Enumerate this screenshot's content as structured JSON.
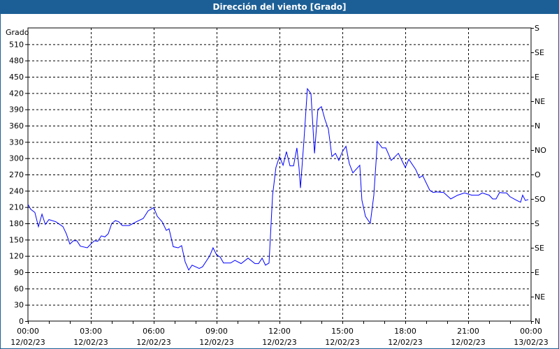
{
  "window": {
    "title": "Dirección del viento [Grado]"
  },
  "colors": {
    "titlebar": "#1c5f96",
    "line": "#0000ff",
    "grid": "#000000"
  },
  "chart_data": {
    "type": "line",
    "title": "Dirección del viento [Grado]",
    "ylabel": "Grado",
    "ylim": [
      0,
      540
    ],
    "xlim_hours": [
      0,
      24
    ],
    "grid": true,
    "yticks": [
      0,
      30,
      60,
      90,
      120,
      150,
      180,
      210,
      240,
      270,
      300,
      330,
      360,
      390,
      420,
      450,
      480,
      510
    ],
    "right_axis_labels": [
      {
        "value": 0,
        "label": "N"
      },
      {
        "value": 45,
        "label": "NE"
      },
      {
        "value": 90,
        "label": "E"
      },
      {
        "value": 135,
        "label": "SE"
      },
      {
        "value": 180,
        "label": "S"
      },
      {
        "value": 225,
        "label": "SO"
      },
      {
        "value": 270,
        "label": "O"
      },
      {
        "value": 315,
        "label": "NO"
      },
      {
        "value": 360,
        "label": "N"
      },
      {
        "value": 405,
        "label": "NE"
      },
      {
        "value": 450,
        "label": "E"
      },
      {
        "value": 495,
        "label": "SE"
      },
      {
        "value": 540,
        "label": "S"
      }
    ],
    "xticks": [
      {
        "hour": 0,
        "time": "00:00",
        "date": "12/02/23"
      },
      {
        "hour": 3,
        "time": "03:00",
        "date": "12/02/23"
      },
      {
        "hour": 6,
        "time": "06:00",
        "date": "12/02/23"
      },
      {
        "hour": 9,
        "time": "09:00",
        "date": "12/02/23"
      },
      {
        "hour": 12,
        "time": "12:00",
        "date": "12/02/23"
      },
      {
        "hour": 15,
        "time": "15:00",
        "date": "12/02/23"
      },
      {
        "hour": 18,
        "time": "18:00",
        "date": "12/02/23"
      },
      {
        "hour": 21,
        "time": "21:00",
        "date": "12/02/23"
      },
      {
        "hour": 24,
        "time": "00:00",
        "date": "13/02/23"
      }
    ],
    "series": [
      {
        "name": "Dirección del viento",
        "x": [
          0,
          0.13,
          0.33,
          0.5,
          0.67,
          0.83,
          1.0,
          1.33,
          1.67,
          1.83,
          2.0,
          2.17,
          2.33,
          2.5,
          2.83,
          3.0,
          3.17,
          3.33,
          3.5,
          3.67,
          3.83,
          4.0,
          4.17,
          4.33,
          4.5,
          4.83,
          5.17,
          5.5,
          5.73,
          6.0,
          6.17,
          6.4,
          6.6,
          6.73,
          6.93,
          7.17,
          7.33,
          7.5,
          7.67,
          7.83,
          8.17,
          8.33,
          8.67,
          8.83,
          9.0,
          9.17,
          9.33,
          9.67,
          9.87,
          10.17,
          10.5,
          10.83,
          11.0,
          11.17,
          11.33,
          11.5,
          11.67,
          11.83,
          12.0,
          12.17,
          12.33,
          12.5,
          12.67,
          12.83,
          12.93,
          13.0,
          13.17,
          13.33,
          13.5,
          13.67,
          13.83,
          14.0,
          14.17,
          14.33,
          14.5,
          14.67,
          14.83,
          15.0,
          15.17,
          15.33,
          15.5,
          15.83,
          15.93,
          16.1,
          16.33,
          16.5,
          16.67,
          16.9,
          17.07,
          17.33,
          17.67,
          18.0,
          18.17,
          18.5,
          18.67,
          18.83,
          19.17,
          19.33,
          19.5,
          19.83,
          20.17,
          20.5,
          20.83,
          21.17,
          21.5,
          21.67,
          22.0,
          22.17,
          22.33,
          22.5,
          22.67,
          22.83,
          23.0,
          23.33,
          23.5,
          23.6,
          23.73,
          23.87
        ],
        "y": [
          215,
          206,
          200,
          174,
          197,
          178,
          187,
          183,
          174,
          161,
          142,
          148,
          148,
          138,
          135,
          142,
          148,
          147,
          157,
          155,
          161,
          180,
          185,
          183,
          176,
          176,
          183,
          189,
          203,
          209,
          193,
          183,
          167,
          170,
          137,
          135,
          139,
          109,
          94,
          103,
          97,
          100,
          120,
          135,
          122,
          118,
          107,
          107,
          112,
          106,
          116,
          106,
          106,
          116,
          103,
          107,
          232,
          283,
          303,
          287,
          312,
          286,
          286,
          319,
          283,
          245,
          335,
          428,
          419,
          309,
          390,
          395,
          371,
          354,
          303,
          309,
          296,
          312,
          322,
          290,
          273,
          287,
          223,
          193,
          180,
          232,
          331,
          319,
          319,
          296,
          309,
          283,
          298,
          279,
          264,
          268,
          241,
          237,
          238,
          237,
          225,
          232,
          236,
          232,
          232,
          236,
          232,
          225,
          225,
          237,
          236,
          236,
          229,
          222,
          219,
          232,
          222,
          224
        ]
      }
    ]
  }
}
